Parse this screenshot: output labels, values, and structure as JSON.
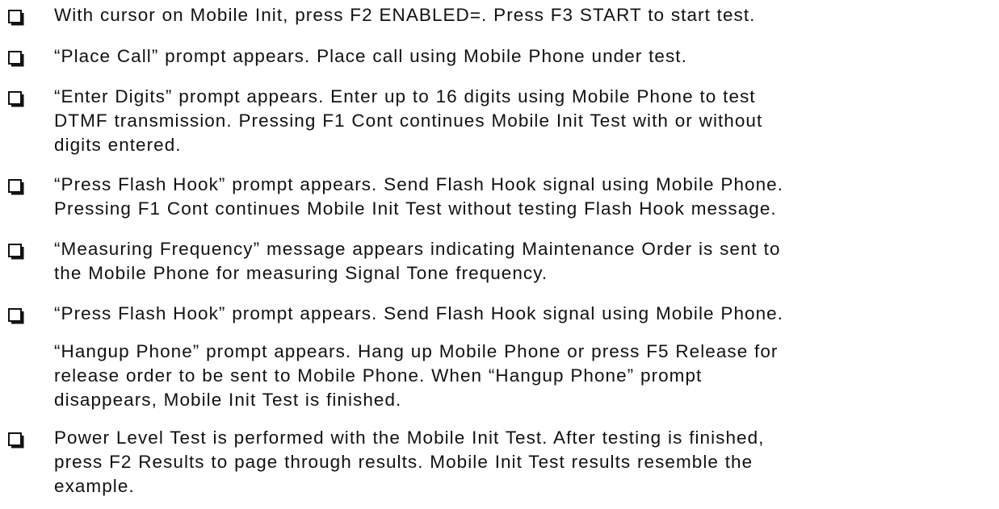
{
  "checklist": {
    "items": [
      {
        "checkbox": true,
        "text": "With cursor on Mobile Init, press F2 ENABLED=.  Press F3 START to start test."
      },
      {
        "checkbox": true,
        "text": "“Place Call” prompt appears.  Place call using Mobile Phone under test."
      },
      {
        "checkbox": true,
        "text": "“Enter Digits” prompt appears.  Enter up to 16 digits using Mobile Phone to test\nDTMF transmission.  Pressing F1 Cont continues Mobile Init Test with or without\ndigits entered."
      },
      {
        "checkbox": true,
        "text": "“Press Flash Hook” prompt appears.  Send Flash Hook signal using Mobile Phone.\nPressing F1 Cont continues Mobile Init Test without testing Flash Hook message."
      },
      {
        "checkbox": true,
        "text": "“Measuring Frequency” message appears indicating Maintenance Order is sent to\nthe Mobile Phone for measuring Signal Tone frequency."
      },
      {
        "checkbox": true,
        "text": "“Press Flash Hook” prompt appears.  Send Flash Hook signal using Mobile Phone."
      },
      {
        "checkbox": false,
        "text": "“Hangup Phone” prompt appears.  Hang up Mobile Phone or press F5 Release for\nrelease order to be sent to Mobile Phone.  When “Hangup Phone” prompt\ndisappears, Mobile Init Test is finished."
      },
      {
        "checkbox": true,
        "text": "Power Level Test is performed with the Mobile Init Test.  After testing is finished,\npress F2 Results to page through results.  Mobile Init Test results resemble the\nexample."
      }
    ]
  }
}
